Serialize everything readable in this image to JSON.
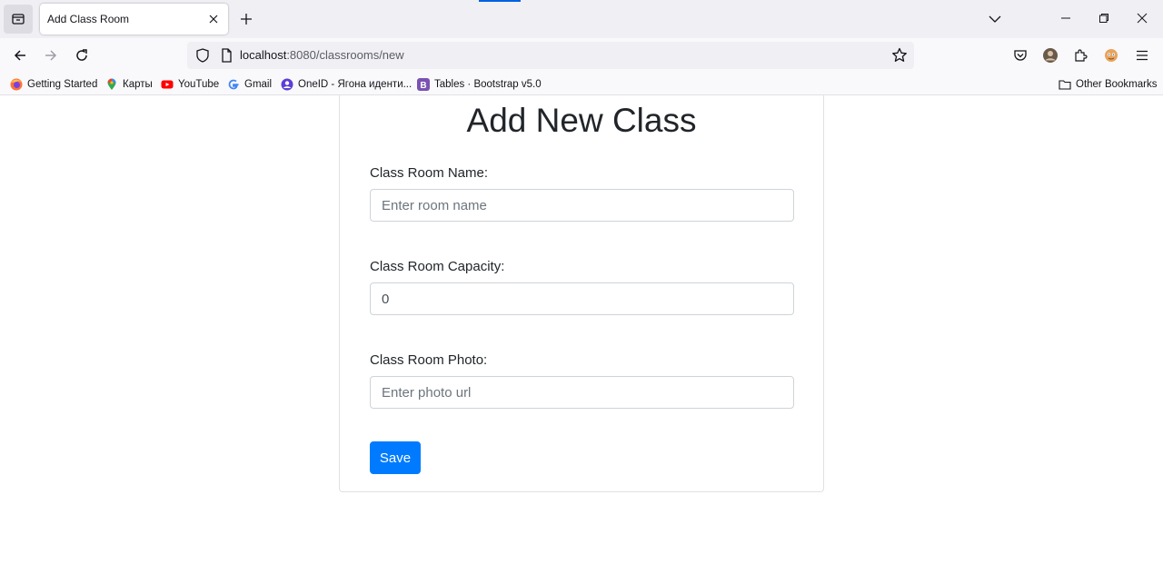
{
  "browser": {
    "tab_title": "Add Class Room",
    "url_host": "localhost",
    "url_rest": ":8080/classrooms/new",
    "bookmarks": [
      {
        "label": "Getting Started",
        "icon": "firefox-icon"
      },
      {
        "label": "Карты",
        "icon": "maps-pin-icon"
      },
      {
        "label": "YouTube",
        "icon": "youtube-icon"
      },
      {
        "label": "Gmail",
        "icon": "google-g-icon"
      },
      {
        "label": "OneID - Ягона иденти...",
        "icon": "user-circle-icon"
      },
      {
        "label": "Tables · Bootstrap v5.0",
        "icon": "bootstrap-icon"
      }
    ],
    "other_bookmarks": "Other Bookmarks"
  },
  "page": {
    "title": "Add New Class",
    "fields": [
      {
        "label": "Class Room Name:",
        "value": "",
        "placeholder": "Enter room name"
      },
      {
        "label": "Class Room Capacity:",
        "value": "0",
        "placeholder": ""
      },
      {
        "label": "Class Room Photo:",
        "value": "",
        "placeholder": "Enter photo url"
      }
    ],
    "save_label": "Save"
  },
  "colors": {
    "primary": "#007bff",
    "chrome_bg": "#f0f0f4",
    "input_border": "#ced4da"
  }
}
